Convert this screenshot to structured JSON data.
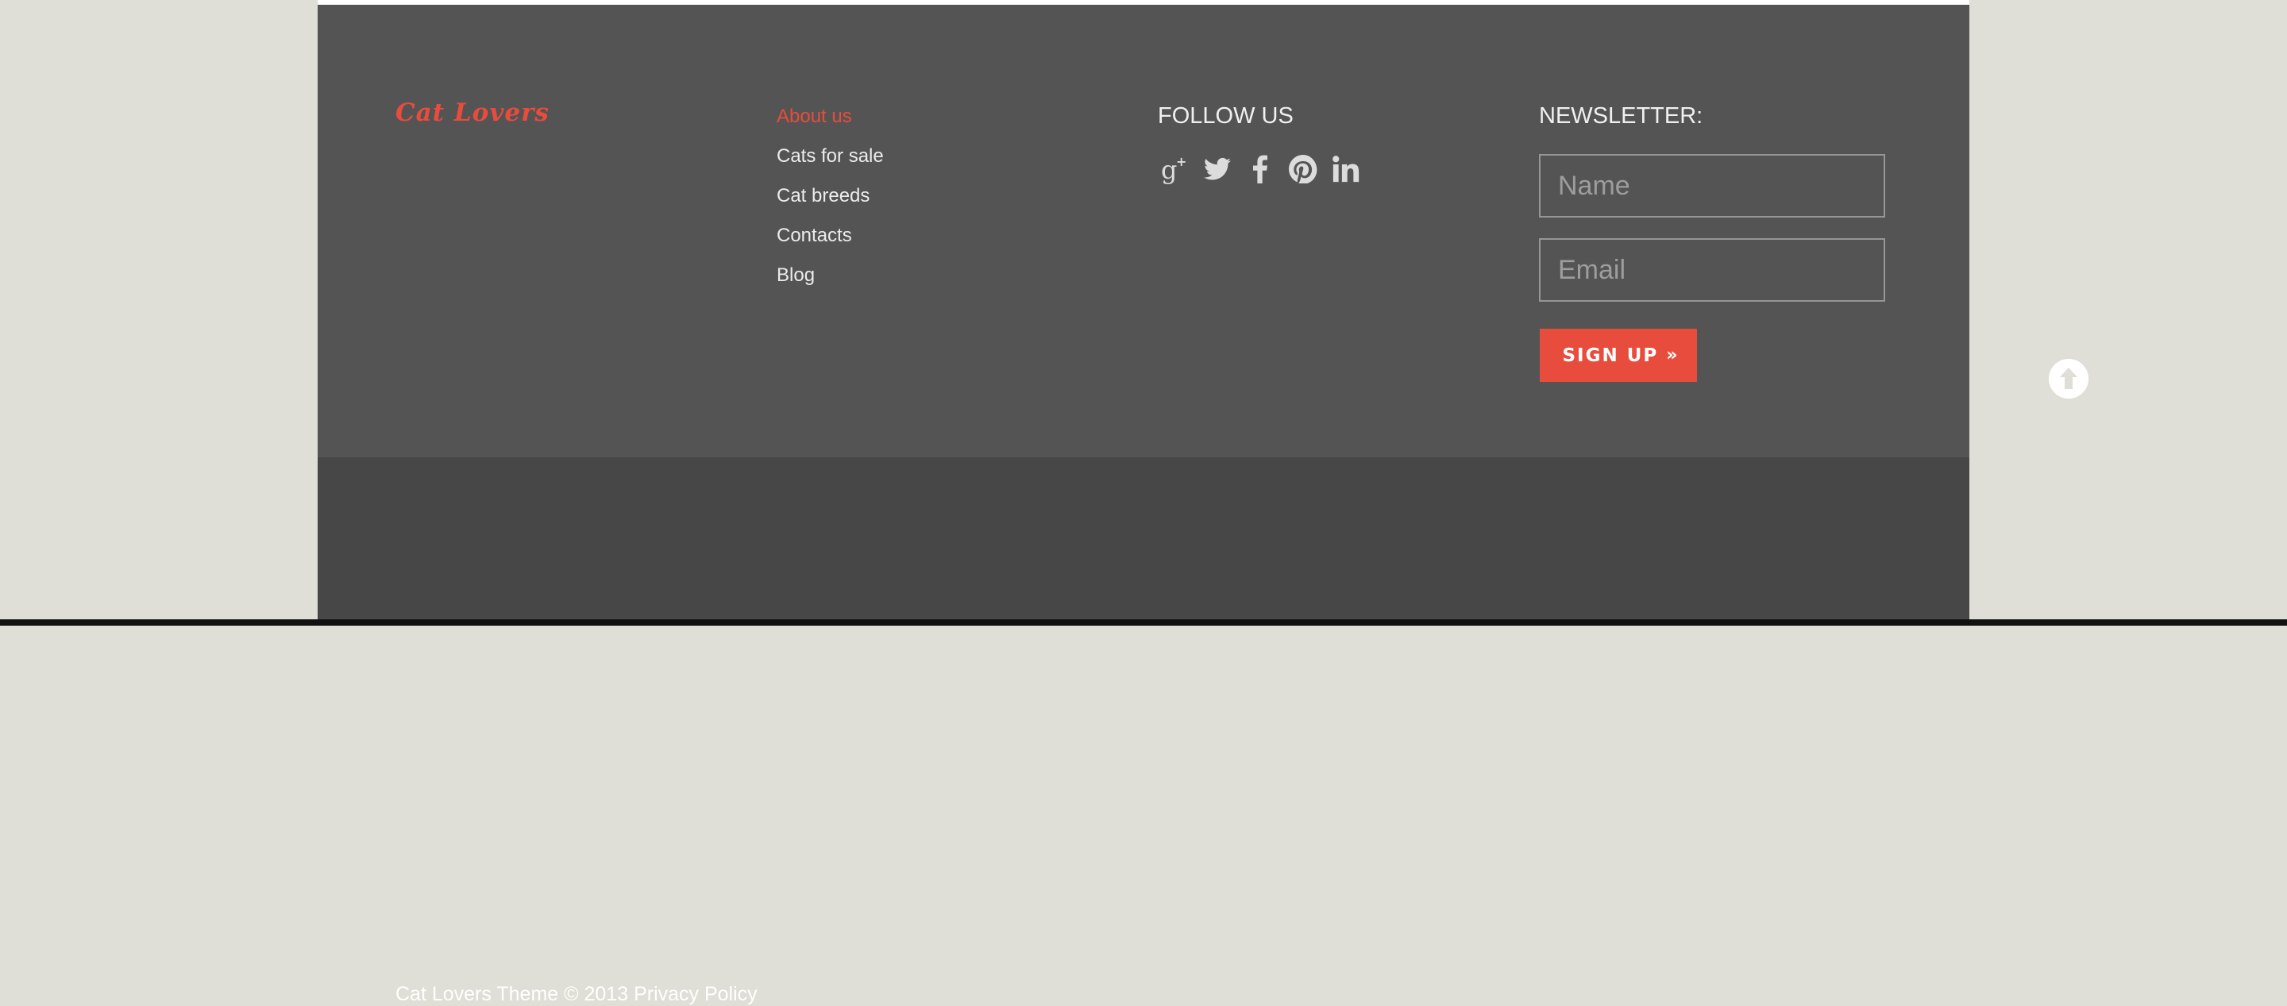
{
  "logo": {
    "text": "Cat Lovers"
  },
  "nav": {
    "items": [
      {
        "label": "About us",
        "active": true
      },
      {
        "label": "Cats for sale",
        "active": false
      },
      {
        "label": "Cat breeds",
        "active": false
      },
      {
        "label": "Contacts",
        "active": false
      },
      {
        "label": "Blog",
        "active": false
      }
    ]
  },
  "follow": {
    "heading": "FOLLOW US",
    "icons": [
      "google-plus-icon",
      "twitter-icon",
      "facebook-icon",
      "pinterest-icon",
      "linkedin-icon"
    ]
  },
  "newsletter": {
    "heading": "NEWSLETTER:",
    "name_placeholder": "Name",
    "email_placeholder": "Email",
    "signup_label": "SIGN UP",
    "signup_arrow": "»"
  },
  "footer": {
    "copyright": "Cat Lovers Theme © 2013",
    "privacy_link": "Privacy Policy"
  },
  "colors": {
    "accent": "#e84c3d",
    "footer_top": "#545454",
    "footer_bottom": "#474747",
    "side_background": "#dfdfd7"
  }
}
